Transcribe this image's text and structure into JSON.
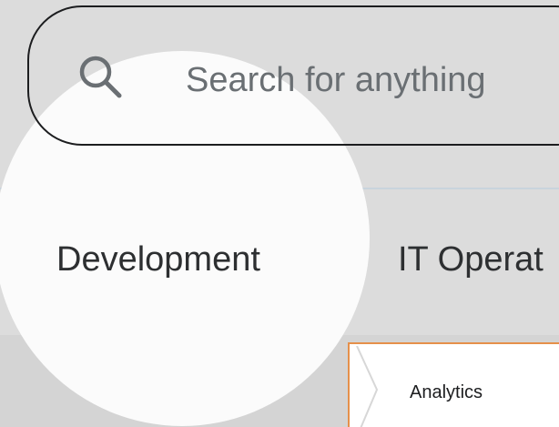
{
  "search": {
    "placeholder": "Search for anything"
  },
  "nav": {
    "items": [
      {
        "label": "Development"
      },
      {
        "label": "IT Operat"
      }
    ]
  },
  "submenu": {
    "item_label": "Analytics"
  },
  "colors": {
    "background": "#dcdcdc",
    "spotlight": "#fbfbfb",
    "text_primary": "#2d2f31",
    "text_muted": "#6a6f73",
    "accent_orange": "#e5904a",
    "divider": "#c9d4dd"
  },
  "icons": {
    "search": "search-icon",
    "submenu_chevron": "chevron-right-icon"
  }
}
